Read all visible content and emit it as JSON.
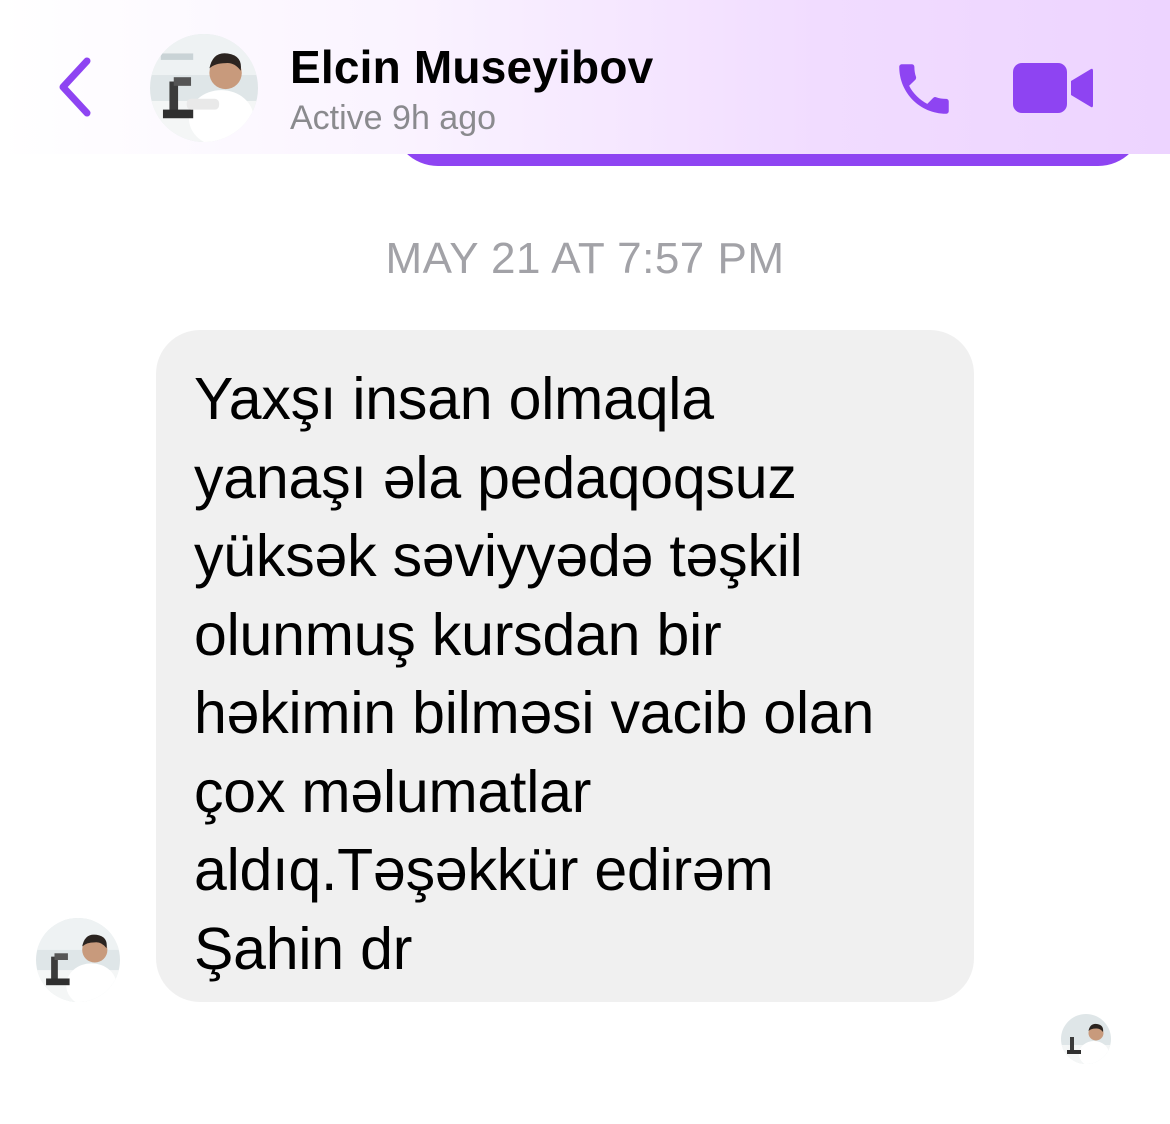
{
  "header": {
    "contact_name": "Elcin Museyibov",
    "status": "Active 9h ago",
    "back_icon": "chevron-left-icon",
    "call_icon": "phone-icon",
    "video_icon": "video-camera-icon"
  },
  "thread": {
    "timestamp": "MAY 21 AT 7:57 PM",
    "messages": [
      {
        "text": "Yaxşı insan olmaqla\nyanaşı əla pedaqoqsuz\nyüksək səviyyədə təşkil\nolunmuş kursdan bir\nhəkimin bilməsi vacib olan\nçox məlumatlar\naldıq.Təşəkkür edirəm\nŞahin dr"
      }
    ]
  },
  "colors": {
    "accent": "#8e44f2",
    "incoming_bubble": "#f0f0f0",
    "secondary_text": "#8a8a8e"
  }
}
